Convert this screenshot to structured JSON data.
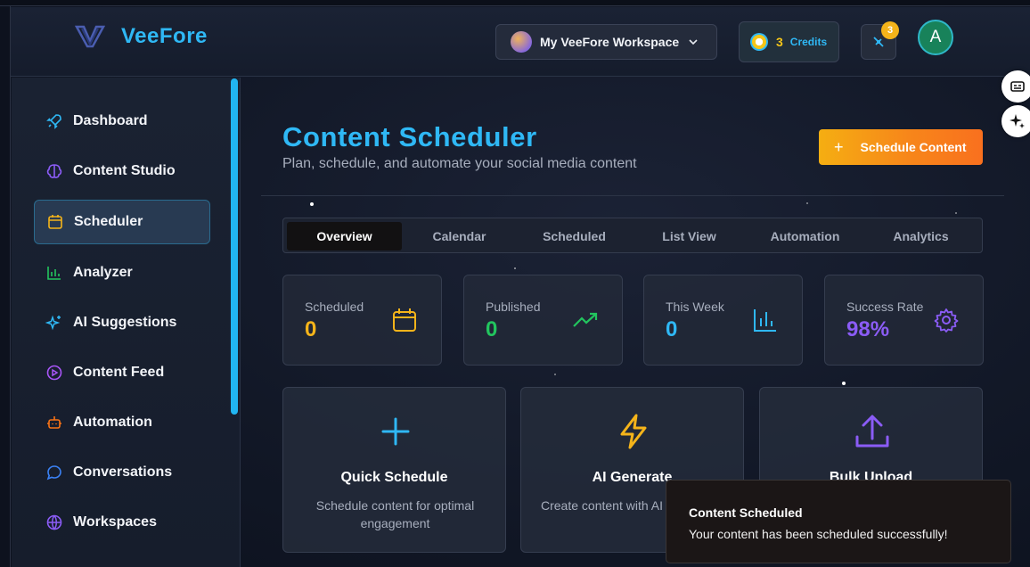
{
  "app": {
    "brand": "VeeFore",
    "workspace_label": "My VeeFore Workspace",
    "credits_value": "3",
    "credits_label": "Credits",
    "notification_count": "3",
    "user_initial": "A"
  },
  "sidebar": {
    "items": [
      {
        "label": "Dashboard",
        "icon": "rocket-icon",
        "color": "#2fb8f5"
      },
      {
        "label": "Content Studio",
        "icon": "brain-icon",
        "color": "#8b5cf6"
      },
      {
        "label": "Scheduler",
        "icon": "calendar-icon",
        "color": "#f5b41a",
        "active": true
      },
      {
        "label": "Analyzer",
        "icon": "bar-chart-icon",
        "color": "#22c55e"
      },
      {
        "label": "AI Suggestions",
        "icon": "sparkles-icon",
        "color": "#2fb8f5"
      },
      {
        "label": "Content Feed",
        "icon": "play-circle-icon",
        "color": "#a855f7"
      },
      {
        "label": "Automation",
        "icon": "bot-icon",
        "color": "#f97316"
      },
      {
        "label": "Conversations",
        "icon": "message-icon",
        "color": "#3b82f6"
      },
      {
        "label": "Workspaces",
        "icon": "globe-icon",
        "color": "#8b5cf6"
      }
    ]
  },
  "main": {
    "title": "Content Scheduler",
    "subtitle": "Plan, schedule, and automate your social media content",
    "schedule_button": "Schedule Content",
    "tabs": [
      "Overview",
      "Calendar",
      "Scheduled",
      "List View",
      "Automation",
      "Analytics"
    ],
    "active_tab": "Overview",
    "stats": [
      {
        "label": "Scheduled",
        "value": "0",
        "color": "#f5b41a",
        "icon": "calendar-icon"
      },
      {
        "label": "Published",
        "value": "0",
        "color": "#22c55e",
        "icon": "trending-up-icon"
      },
      {
        "label": "This Week",
        "value": "0",
        "color": "#2fb8f5",
        "icon": "bar-chart-icon"
      },
      {
        "label": "Success Rate",
        "value": "98%",
        "color": "#8b5cf6",
        "icon": "gear-icon"
      }
    ],
    "cards": [
      {
        "title": "Quick Schedule",
        "desc": "Schedule content for optimal engagement",
        "icon": "plus-icon",
        "color": "#2fb8f5"
      },
      {
        "title": "AI Generate",
        "desc": "Create content with AI assistance",
        "icon": "lightning-icon",
        "color": "#f5b41a"
      },
      {
        "title": "Bulk Upload",
        "desc": "",
        "icon": "upload-icon",
        "color": "#8b5cf6"
      }
    ]
  },
  "toast": {
    "title": "Content Scheduled",
    "message": "Your content has been scheduled successfully!"
  }
}
